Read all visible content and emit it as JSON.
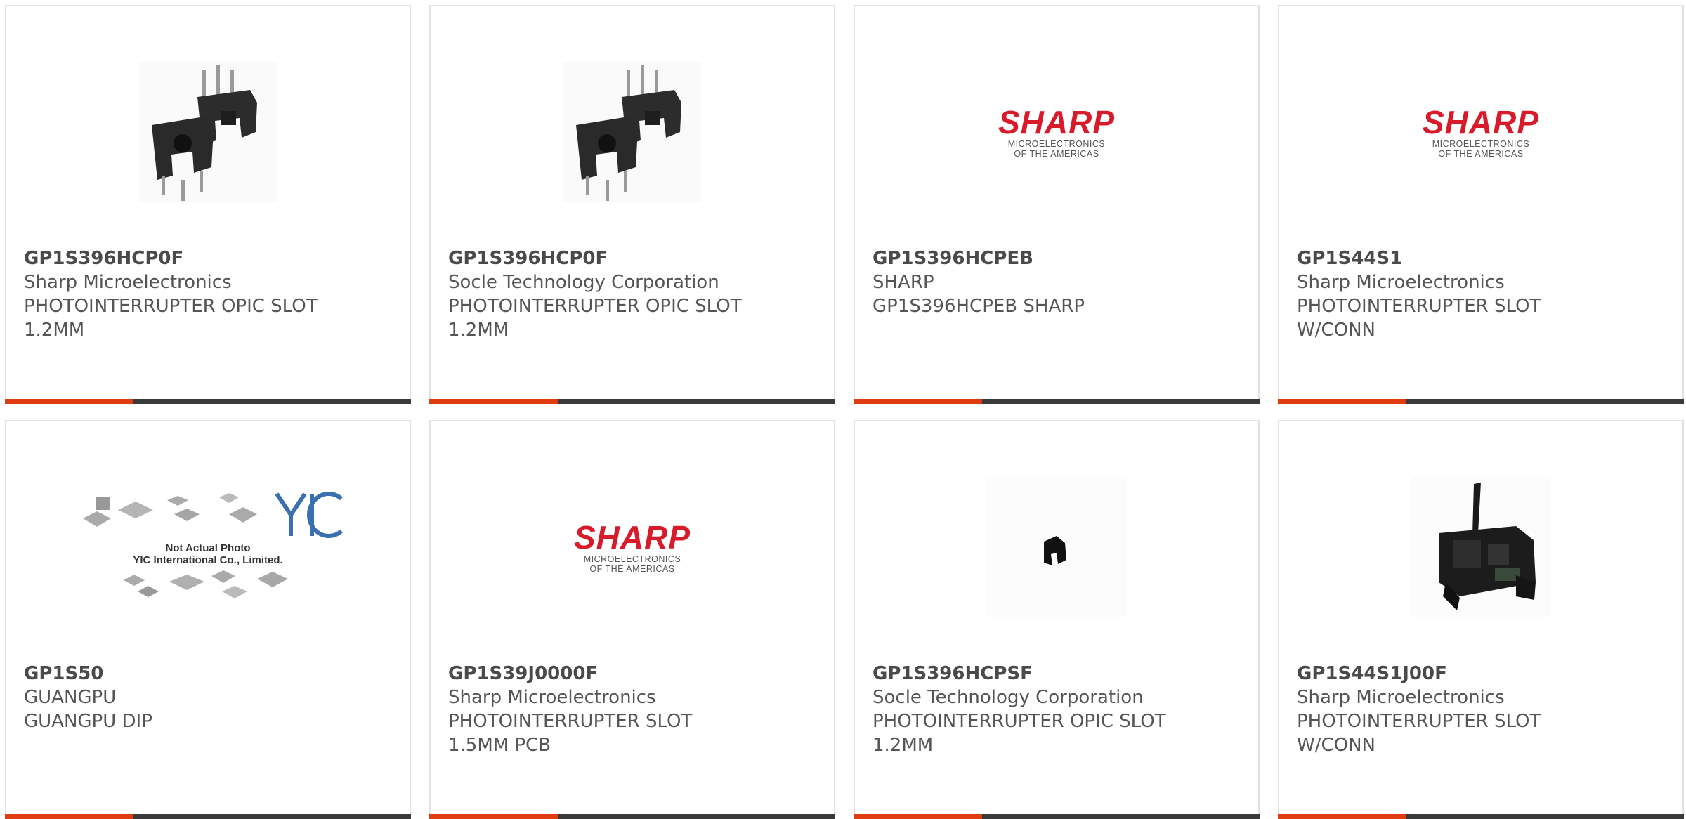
{
  "accent_color": "#e03c12",
  "bar_color": "#3a3a3a",
  "products": [
    {
      "part_number": "GP1S396HCP0F",
      "manufacturer": "Sharp Microelectronics",
      "desc1": "PHOTOINTERRUPTER OPIC SLOT",
      "desc2": "1.2MM",
      "image": "photointerrupter-pair-photo"
    },
    {
      "part_number": "GP1S396HCP0F",
      "manufacturer": "Socle Technology Corporation",
      "desc1": "PHOTOINTERRUPTER OPIC SLOT",
      "desc2": "1.2MM",
      "image": "photointerrupter-pair-photo"
    },
    {
      "part_number": "GP1S396HCPEB",
      "manufacturer": "SHARP",
      "desc1": "GP1S396HCPEB SHARP",
      "desc2": "",
      "image": "sharp-logo"
    },
    {
      "part_number": "GP1S44S1",
      "manufacturer": "Sharp Microelectronics",
      "desc1": "PHOTOINTERRUPTER SLOT",
      "desc2": "W/CONN",
      "image": "sharp-logo"
    },
    {
      "part_number": "GP1S50",
      "manufacturer": "GUANGPU",
      "desc1": "GUANGPU DIP",
      "desc2": "",
      "image": "yic-placeholder"
    },
    {
      "part_number": "GP1S39J0000F",
      "manufacturer": "Sharp Microelectronics",
      "desc1": "PHOTOINTERRUPTER SLOT",
      "desc2": "1.5MM PCB",
      "image": "sharp-logo"
    },
    {
      "part_number": "GP1S396HCPSF",
      "manufacturer": "Socle Technology Corporation",
      "desc1": "PHOTOINTERRUPTER OPIC SLOT",
      "desc2": "1.2MM",
      "image": "small-component-photo"
    },
    {
      "part_number": "GP1S44S1J00F",
      "manufacturer": "Sharp Microelectronics",
      "desc1": "PHOTOINTERRUPTER SLOT",
      "desc2": "W/CONN",
      "image": "connector-component-photo"
    }
  ],
  "sharp_logo": {
    "word": "SHARP",
    "line1": "MICROELECTRONICS",
    "line2": "OF THE AMERICAS"
  },
  "yic_placeholder": {
    "line1": "Not Actual Photo",
    "line2": "YIC International Co., Limited."
  }
}
